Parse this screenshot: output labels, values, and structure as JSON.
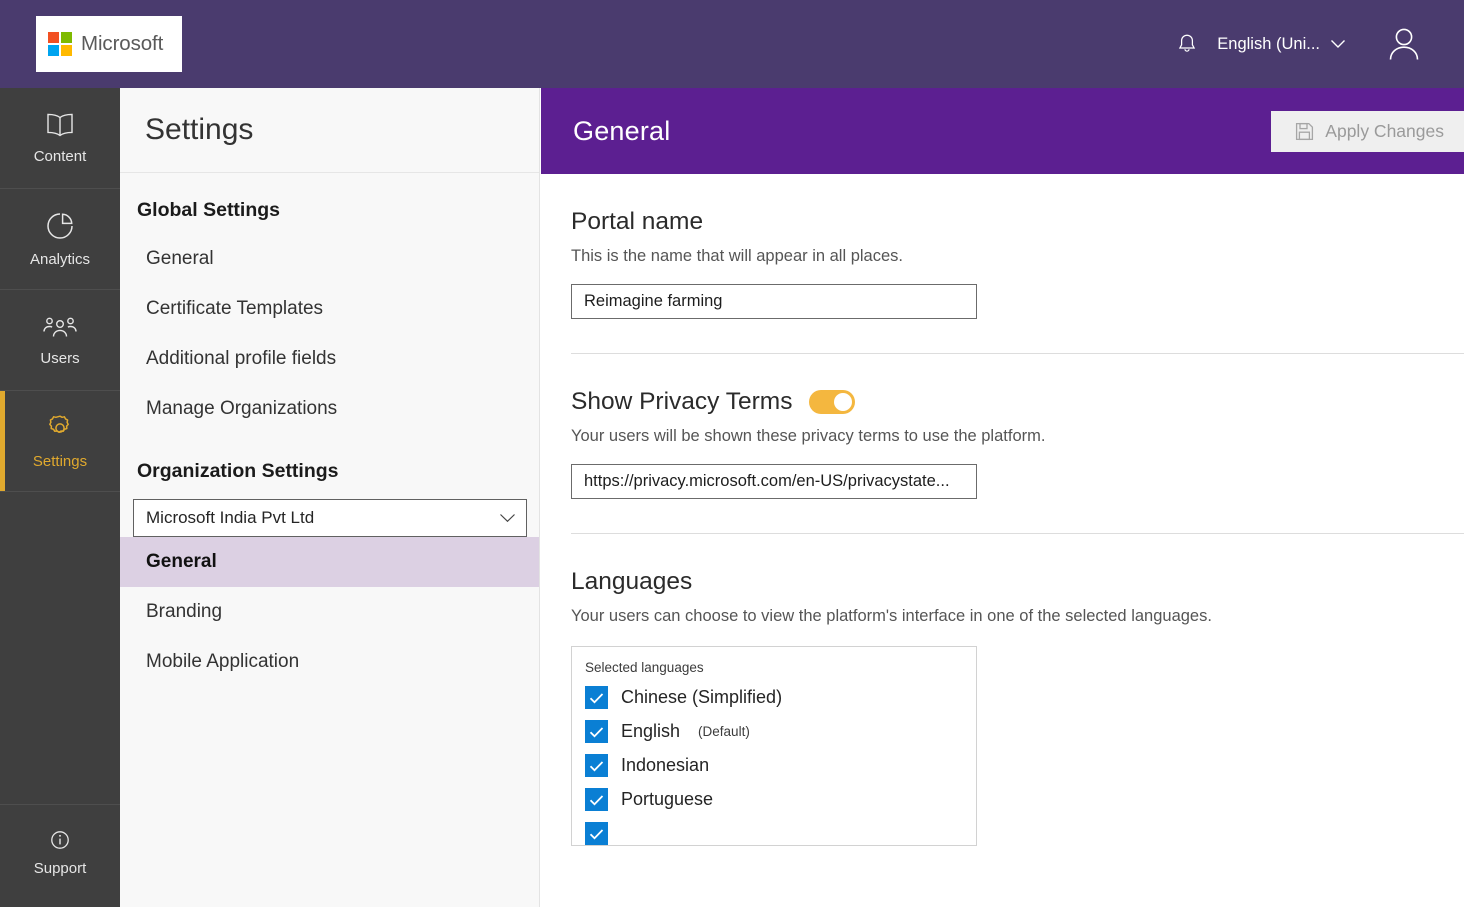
{
  "topbar": {
    "brand": "Microsoft",
    "brand_colors": [
      "#f25022",
      "#7fba00",
      "#00a4ef",
      "#ffb900"
    ],
    "notifications_icon": "bell-icon",
    "language": "English (Uni...",
    "language_chevron_icon": "chevron-down-icon",
    "account_icon": "user-avatar-icon",
    "background": "#4a3b6e"
  },
  "rail": {
    "items": [
      {
        "label": "Content",
        "icon": "book-icon",
        "active": false
      },
      {
        "label": "Analytics",
        "icon": "pie-chart-icon",
        "active": false
      },
      {
        "label": "Users",
        "icon": "people-icon",
        "active": false
      },
      {
        "label": "Settings",
        "icon": "gear-icon",
        "active": true
      }
    ],
    "bottom": {
      "label": "Support",
      "icon": "info-circle-icon"
    },
    "accent": "#e0a92e",
    "background": "#3f3f3f"
  },
  "navpanel": {
    "title": "Settings",
    "global_group": {
      "heading": "Global Settings",
      "items": [
        {
          "label": "General",
          "active": false
        },
        {
          "label": "Certificate Templates",
          "active": false
        },
        {
          "label": "Additional profile fields",
          "active": false
        },
        {
          "label": "Manage Organizations",
          "active": false
        }
      ]
    },
    "organization_group": {
      "heading": "Organization Settings",
      "org_select": {
        "value": "Microsoft India Pvt Ltd",
        "chevron_icon": "chevron-down-icon"
      },
      "items": [
        {
          "label": "General",
          "active": true
        },
        {
          "label": "Branding",
          "active": false
        },
        {
          "label": "Mobile Application",
          "active": false
        }
      ]
    },
    "active_highlight_color": "#dcd0e3"
  },
  "content": {
    "header": {
      "title": "General",
      "background": "#5c1f91",
      "apply_button": {
        "label": "Apply Changes",
        "icon": "save-floppy-icon",
        "disabled": true
      }
    },
    "portal_name": {
      "heading": "Portal name",
      "description": "This is the name that will appear in all places.",
      "value": "Reimagine farming",
      "placeholder": "Portal name"
    },
    "privacy_terms": {
      "heading": "Show Privacy Terms",
      "toggle_on": true,
      "toggle_color": "#f4b73f",
      "description": "Your users will be shown these privacy terms to use the platform.",
      "url_value": "https://privacy.microsoft.com/en-US/privacystate...",
      "url_placeholder": "Privacy terms URL"
    },
    "languages": {
      "heading": "Languages",
      "description": "Your users can choose to view the platform's interface in one of the selected languages.",
      "box_label": "Selected languages",
      "checkbox_color": "#0a7fd4",
      "items": [
        {
          "name": "Chinese (Simplified)",
          "checked": true,
          "tag": ""
        },
        {
          "name": "English",
          "checked": true,
          "tag": "(Default)"
        },
        {
          "name": "Indonesian",
          "checked": true,
          "tag": ""
        },
        {
          "name": "Portuguese",
          "checked": true,
          "tag": ""
        },
        {
          "name": "",
          "checked": true,
          "tag": ""
        }
      ]
    }
  }
}
